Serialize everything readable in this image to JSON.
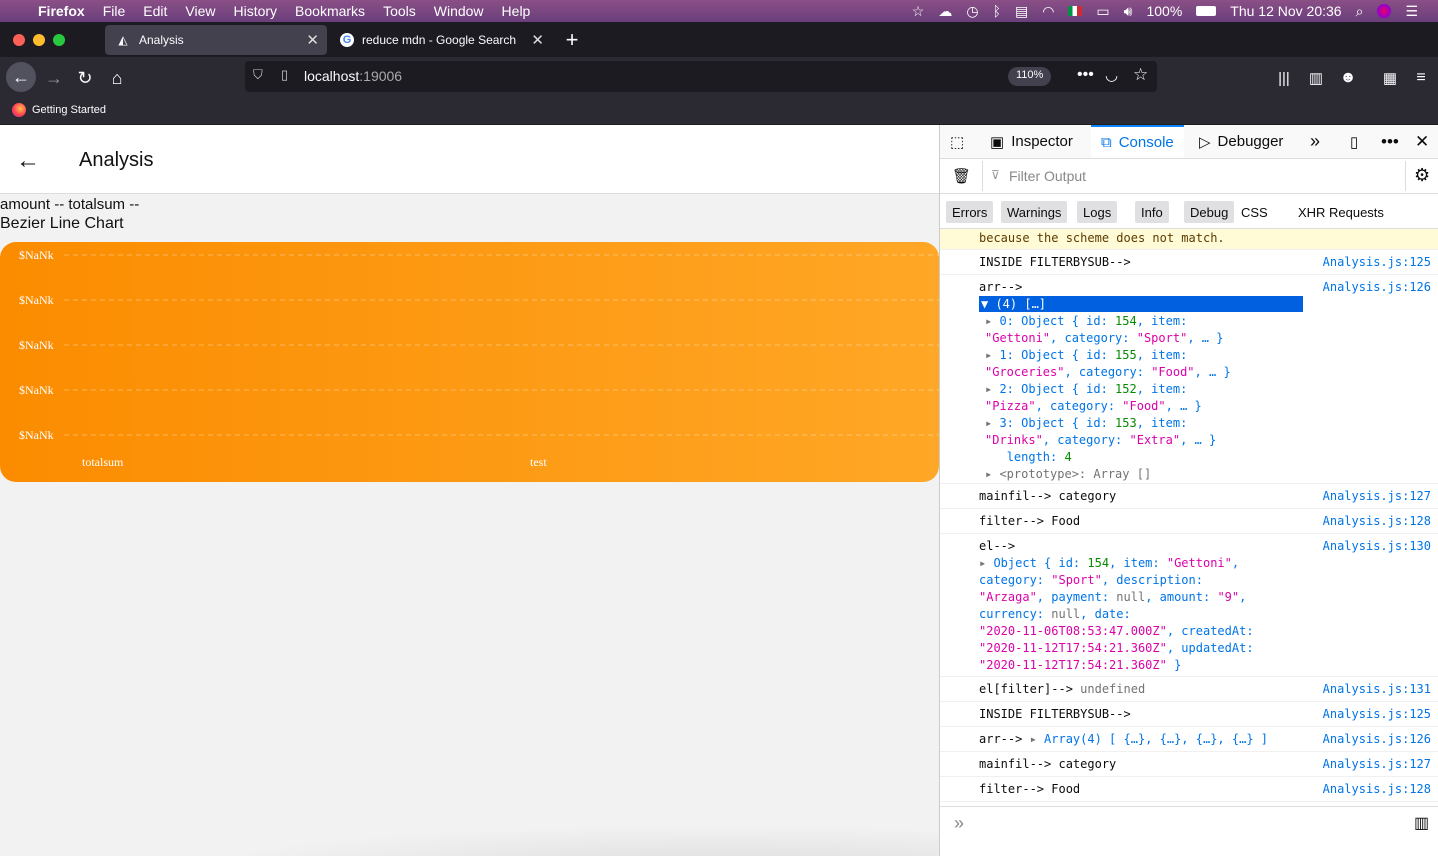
{
  "macos_menu": {
    "app": "Firefox",
    "items": [
      "File",
      "Edit",
      "View",
      "History",
      "Bookmarks",
      "Tools",
      "Window",
      "Help"
    ],
    "battery": "100%",
    "datetime": "Thu 12 Nov  20:36"
  },
  "tabs": [
    {
      "title": "Analysis"
    },
    {
      "title": "reduce mdn - Google Search"
    }
  ],
  "url": {
    "host": "localhost",
    "port": ":19006",
    "zoom": "110%"
  },
  "bookmarks": {
    "item": "Getting Started"
  },
  "app": {
    "title": "Analysis",
    "summary_line": "amount -- totalsum --",
    "chart_heading": "Bezier Line Chart"
  },
  "chart_data": {
    "type": "line",
    "categories": [
      "totalsum",
      "test"
    ],
    "yticks": [
      "$NaNk",
      "$NaNk",
      "$NaNk",
      "$NaNk",
      "$NaNk"
    ],
    "values": [],
    "colors": {
      "bg_from": "#fb8c00",
      "bg_to": "#ffa726",
      "label": "#ffffff"
    }
  },
  "devtools": {
    "tabs": [
      "Inspector",
      "Console",
      "Debugger"
    ],
    "active_tab": "Console",
    "filter_placeholder": "Filter Output",
    "filter_tabs": [
      "Errors",
      "Warnings",
      "Logs",
      "Info",
      "Debug",
      "CSS",
      "XHR",
      "Requests"
    ],
    "warning_tail": "because the scheme does not match.",
    "logs": [
      {
        "msg": "INSIDE FILTERBYSUB-->",
        "src": "Analysis.js:125"
      },
      {
        "msg": "arr-->",
        "src": "Analysis.js:126"
      },
      {
        "msg": "mainfil--> category",
        "src": "Analysis.js:127"
      },
      {
        "msg": "filter--> Food",
        "src": "Analysis.js:128"
      },
      {
        "msg": "el-->",
        "src": "Analysis.js:130"
      },
      {
        "msg": "el[filter]--> ",
        "src": "Analysis.js:131"
      },
      {
        "msg": "INSIDE FILTERBYSUB-->",
        "src": "Analysis.js:125"
      },
      {
        "msg": "arr--> ",
        "src": "Analysis.js:126"
      },
      {
        "msg": "mainfil--> category",
        "src": "Analysis.js:127"
      },
      {
        "msg": "filter--> Food",
        "src": "Analysis.js:128"
      }
    ],
    "array_header": "▼ (4) […]",
    "array_items": [
      {
        "idx": "0",
        "id": "154",
        "item": "\"Gettoni\"",
        "category": "\"Sport\""
      },
      {
        "idx": "1",
        "id": "155",
        "item": "\"Groceries\"",
        "category": "\"Food\""
      },
      {
        "idx": "2",
        "id": "152",
        "item": "\"Pizza\"",
        "category": "\"Food\""
      },
      {
        "idx": "3",
        "id": "153",
        "item": "\"Drinks\"",
        "category": "\"Extra\""
      }
    ],
    "array_length": "4",
    "el_object": {
      "id": "154",
      "item": "\"Gettoni\"",
      "category": "\"Sport\"",
      "description": "\"Arzaga\"",
      "amount": "\"9\"",
      "date": "\"2020-11-06T08:53:47.000Z\"",
      "createdAt": "\"2020-11-12T17:54:21.360Z\"",
      "updatedAt": "\"2020-11-12T17:54:21.360Z\""
    },
    "undefined_value": "undefined",
    "collapsed_array": "Array(4) [ {…}, {…}, {…}, {…} ]"
  }
}
